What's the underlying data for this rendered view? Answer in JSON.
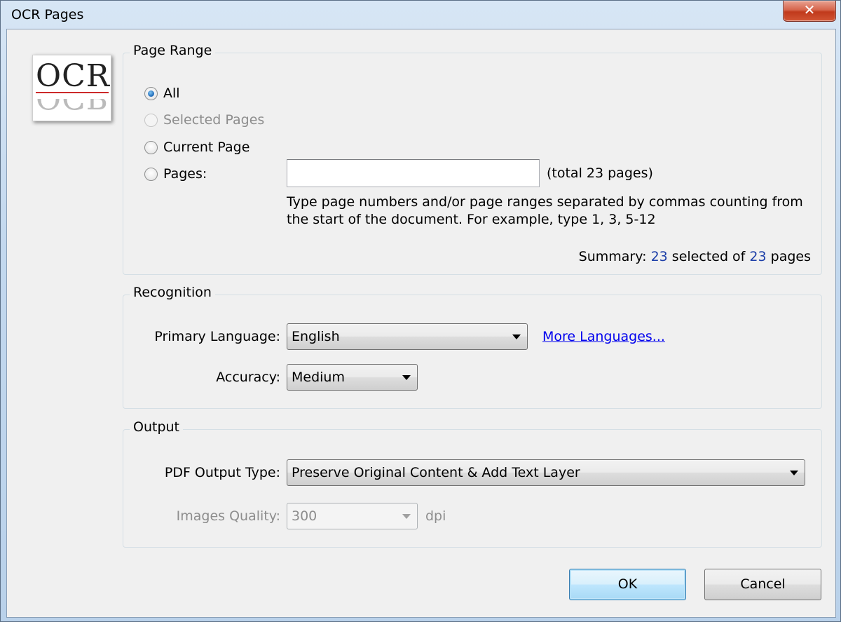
{
  "window": {
    "title": "OCR Pages",
    "close_glyph": "✕"
  },
  "logo": {
    "text": "OCR"
  },
  "page_range": {
    "title": "Page Range",
    "options": [
      {
        "label": "All",
        "checked": true,
        "enabled": true
      },
      {
        "label": "Selected Pages",
        "checked": false,
        "enabled": false
      },
      {
        "label": "Current Page",
        "checked": false,
        "enabled": true
      },
      {
        "label": "Pages:",
        "checked": false,
        "enabled": true
      }
    ],
    "pages_input_value": "",
    "total_text": "(total 23 pages)",
    "hint": "Type page numbers and/or page ranges separated by commas counting from the start of the document. For example, type 1, 3, 5-12",
    "summary": {
      "prefix": "Summary:",
      "selected": "23",
      "middle": "selected of",
      "total": "23",
      "suffix": "pages"
    }
  },
  "recognition": {
    "title": "Recognition",
    "primary_language_label": "Primary Language:",
    "primary_language_value": "English",
    "more_languages": "More Languages...",
    "accuracy_label": "Accuracy:",
    "accuracy_value": "Medium"
  },
  "output": {
    "title": "Output",
    "pdf_output_type_label": "PDF Output Type:",
    "pdf_output_type_value": "Preserve Original Content & Add Text Layer",
    "images_quality_label": "Images Quality:",
    "images_quality_value": "300",
    "images_quality_unit": "dpi"
  },
  "buttons": {
    "ok": "OK",
    "cancel": "Cancel"
  }
}
